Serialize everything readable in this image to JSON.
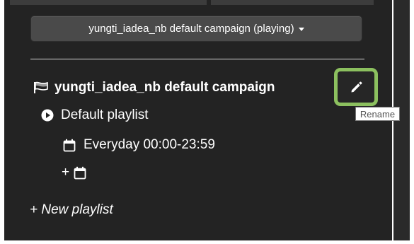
{
  "header": {
    "campaign_dropdown_label": "yungti_iadea_nb default campaign (playing)"
  },
  "campaign": {
    "name": "yungti_iadea_nb default campaign",
    "icon": "flag-icon",
    "rename_tooltip": "Rename",
    "rename_icon": "pencil-icon"
  },
  "playlists": [
    {
      "name": "Default playlist",
      "icon": "play-circle-icon",
      "schedules": [
        {
          "label": "Everyday 00:00-23:59",
          "icon": "calendar-icon"
        }
      ],
      "add_schedule": {
        "plus": "+",
        "icon": "calendar-icon"
      }
    }
  ],
  "new_playlist_label": "+ New playlist",
  "colors": {
    "panel_bg": "#232323",
    "dropdown_bg": "#4a4a4a",
    "highlight": "#8cc05f",
    "text": "#ffffff"
  }
}
